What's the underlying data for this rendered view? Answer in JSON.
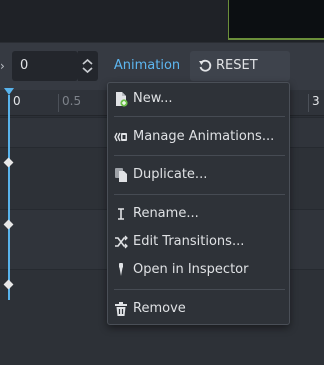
{
  "toolbar": {
    "frame_value": "0",
    "animation_label": "Animation",
    "reset_label": "RESET"
  },
  "timeline": {
    "ticks": [
      "0",
      "0.5",
      "3"
    ]
  },
  "menu": {
    "items": [
      {
        "label": "New...",
        "icon": "new-file-icon"
      },
      {
        "label": "Manage Animations...",
        "icon": "animation-library-icon"
      },
      {
        "label": "Duplicate...",
        "icon": "duplicate-icon"
      },
      {
        "label": "Rename...",
        "icon": "rename-icon"
      },
      {
        "label": "Edit Transitions...",
        "icon": "transitions-icon"
      },
      {
        "label": "Open in Inspector",
        "icon": "inspector-icon"
      },
      {
        "label": "Remove",
        "icon": "trash-icon"
      }
    ]
  },
  "colors": {
    "accent": "#5db6f0",
    "playhead": "#58b3ec",
    "background": "#2c3037",
    "menu_bg": "#2e3238"
  }
}
